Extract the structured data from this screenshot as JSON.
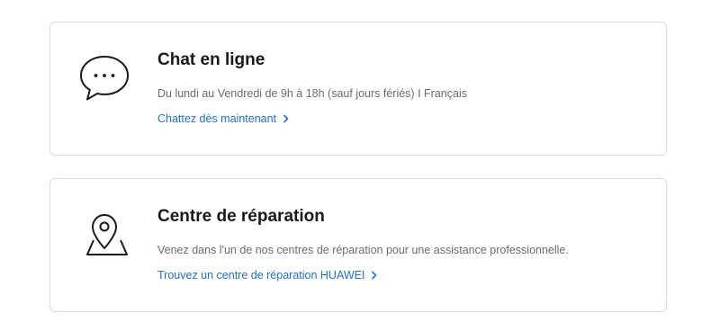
{
  "cards": [
    {
      "icon": "chat-bubble-icon",
      "title": "Chat en ligne",
      "description": "Du lundi au Vendredi de 9h à 18h (sauf jours fériés) I Français",
      "link": "Chattez dès maintenant"
    },
    {
      "icon": "map-pin-icon",
      "title": "Centre de réparation",
      "description": "Venez dans l'un de nos centres de réparation pour une assistance professionnelle.",
      "link": "Trouvez un centre de réparation HUAWEI"
    }
  ],
  "colors": {
    "link": "#1f6fc9",
    "title": "#1a1a1a",
    "description": "#6b6b6b",
    "border": "#dcdcdc"
  }
}
